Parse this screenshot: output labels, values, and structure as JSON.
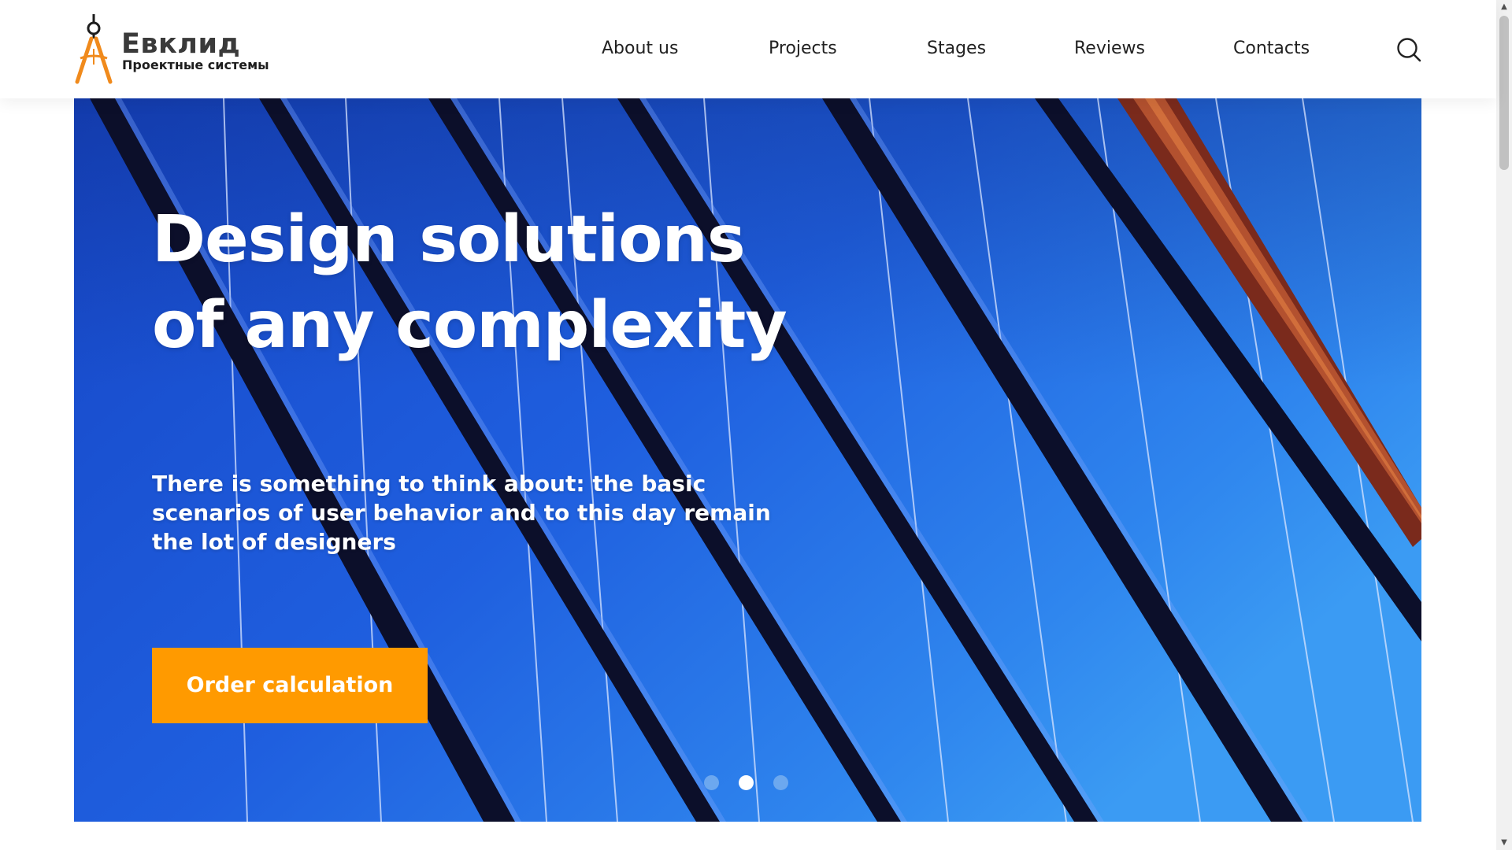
{
  "header": {
    "logo": {
      "name": "Евклид",
      "tagline": "Проектные системы"
    },
    "nav": {
      "about": "About us",
      "projects": "Projects",
      "stages": "Stages",
      "reviews": "Reviews",
      "contacts": "Contacts"
    },
    "search_icon": "search-icon"
  },
  "hero": {
    "title": "Design solutions of any complexity",
    "subtitle": "There is something to think about: the basic scenarios of user behavior and to this day remain the lot of designers",
    "cta_label": "Order calculation",
    "slider": {
      "count": 3,
      "active_index": 2
    }
  },
  "colors": {
    "accent_orange": "#ff9a00",
    "hero_blue": "#1e57d8",
    "text_dark": "#222222",
    "logo_text": "#3a3a3a",
    "white": "#ffffff"
  }
}
